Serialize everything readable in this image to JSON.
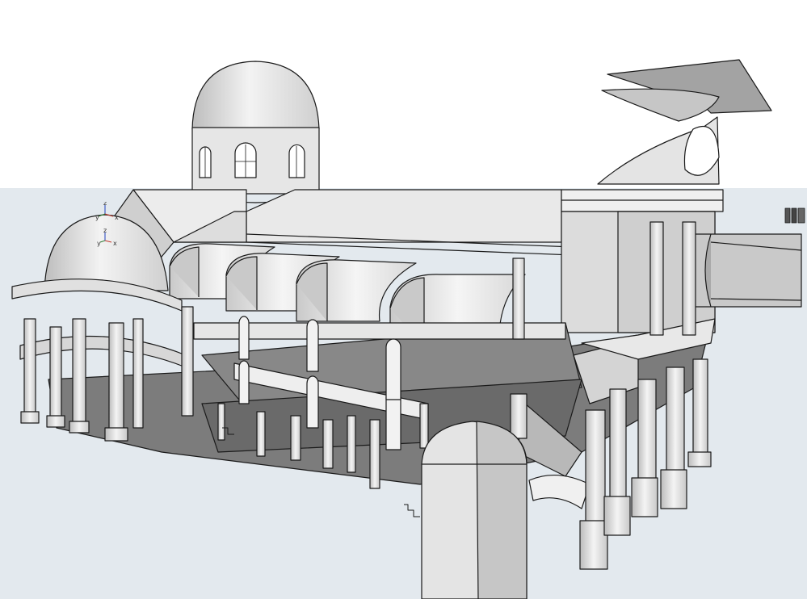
{
  "scene": {
    "description_free": true,
    "colors": {
      "sky": "#ffffff",
      "ground": "#e3e9ee",
      "surface_light": "#f4f4f4",
      "surface_mid": "#d9d9d9",
      "surface_dark": "#a8a8a8",
      "floor_shadow": "#6e6e6e",
      "edge": "#1a1a1a"
    }
  },
  "axes": {
    "z_label": "z",
    "y_label": "y",
    "x_label": "x",
    "colors": {
      "x": "#c0392b",
      "y": "#2e7d32",
      "z": "#1f3fbf"
    }
  }
}
